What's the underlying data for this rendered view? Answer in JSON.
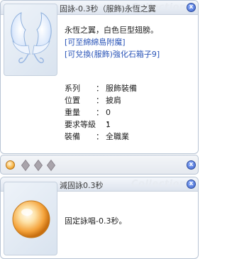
{
  "item_window": {
    "title": "固詠-0.3秒（服飾)永恆之翼",
    "watermark": "Collections",
    "description": "永恆之翼，白色巨型翅膀。",
    "links": [
      "[可至綿綿島附魔]",
      "[可兌換(服飾)強化石箱子9]"
    ],
    "properties": [
      {
        "key": "系列",
        "sep": "：",
        "value": "服飾裝備"
      },
      {
        "key": "位置",
        "sep": "：",
        "value": "披肩"
      },
      {
        "key": "重量",
        "sep": "：",
        "value": "0"
      },
      {
        "key": "要求等級",
        "sep": "：",
        "value": "1"
      },
      {
        "key": "裝備",
        "sep": "：",
        "value": "全職業"
      }
    ],
    "close_label": "x"
  },
  "slot_bar": {
    "close_label": "x"
  },
  "card_window": {
    "title": "減固詠0.3秒",
    "watermark": "Collections",
    "description": "固定詠唱-0.3秒。",
    "close_label": "x"
  }
}
